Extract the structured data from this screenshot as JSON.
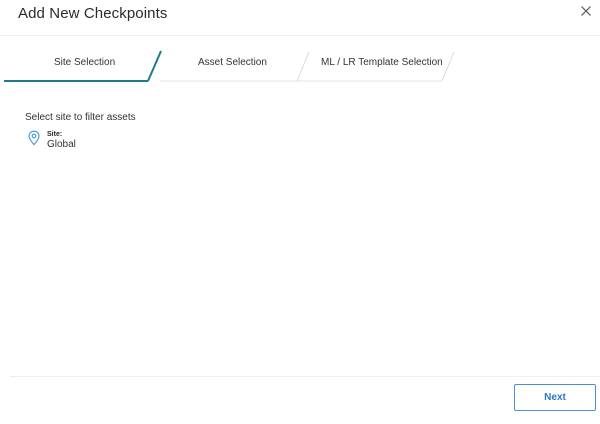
{
  "dialog": {
    "title": "Add New Checkpoints"
  },
  "stepper": {
    "steps": [
      {
        "label": "Site Selection",
        "active": true
      },
      {
        "label": "Asset Selection",
        "active": false
      },
      {
        "label": "ML / LR Template Selection",
        "active": false
      }
    ],
    "accent_color": "#1e7a8c"
  },
  "content": {
    "instruction": "Select site to filter assets",
    "site": {
      "key": "Site:",
      "value": "Global",
      "icon": "location-pin-icon"
    }
  },
  "footer": {
    "next_label": "Next"
  },
  "icons": {
    "close": "close-icon"
  }
}
